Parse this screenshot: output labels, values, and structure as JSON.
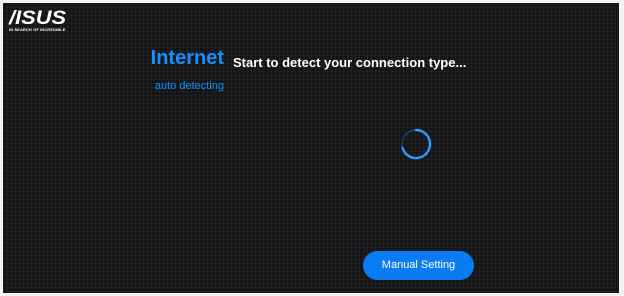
{
  "brand": {
    "logo_text": "/ISUS",
    "tagline": "IN SEARCH OF INCREDIBLE"
  },
  "section": {
    "title": "Internet",
    "subtitle": "auto detecting"
  },
  "main": {
    "headline": "Start to detect your connection type...",
    "manual_button_label": "Manual Setting"
  },
  "icons": {
    "spinner": "loading-spinner-icon"
  },
  "colors": {
    "background": "#141516",
    "accent": "#1a8dff",
    "button": "#0a7cf3",
    "text": "#ffffff"
  }
}
